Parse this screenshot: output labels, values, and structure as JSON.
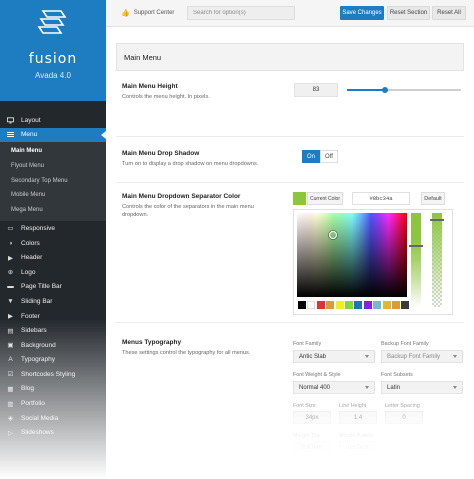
{
  "brand": {
    "name": "fusion",
    "version": "Avada 4.0"
  },
  "sidebar": {
    "items": [
      {
        "label": "Layout",
        "icon": "monitor-icon"
      },
      {
        "label": "Menu",
        "icon": "menu-lines-icon",
        "active": true
      },
      {
        "label": "Responsive",
        "icon": "devices-icon"
      },
      {
        "label": "Colors",
        "icon": "palette-icon"
      },
      {
        "label": "Header",
        "icon": "header-icon"
      },
      {
        "label": "Logo",
        "icon": "plus-circle-icon"
      },
      {
        "label": "Page Title Bar",
        "icon": "page-title-icon"
      },
      {
        "label": "Sliding Bar",
        "icon": "sliding-bar-icon"
      },
      {
        "label": "Footer",
        "icon": "footer-icon"
      },
      {
        "label": "Sidebars",
        "icon": "sidebar-icon"
      },
      {
        "label": "Background",
        "icon": "image-icon"
      },
      {
        "label": "Typography",
        "icon": "typography-icon"
      },
      {
        "label": "Shortcodes Styling",
        "icon": "check-square-icon"
      },
      {
        "label": "Blog",
        "icon": "blog-icon"
      },
      {
        "label": "Portfolio",
        "icon": "portfolio-icon"
      },
      {
        "label": "Social Media",
        "icon": "share-icon"
      },
      {
        "label": "Slideshows",
        "icon": "slideshow-icon"
      }
    ],
    "submenu": [
      {
        "label": "Main Menu",
        "current": true
      },
      {
        "label": "Flyout Menu"
      },
      {
        "label": "Secondary Top Menu"
      },
      {
        "label": "Mobile Menu"
      },
      {
        "label": "Mega Menu"
      }
    ]
  },
  "topbar": {
    "support_label": "Support Center",
    "search_placeholder": "Search for option(s)",
    "save_label": "Save Changes",
    "reset_section_label": "Reset Section",
    "reset_all_label": "Reset All"
  },
  "section": {
    "title": "Main Menu"
  },
  "menu_height": {
    "title": "Main Menu Height",
    "desc": "Controls the menu height. In pixels.",
    "value": "83",
    "slider_fraction": 0.33
  },
  "drop_shadow": {
    "title": "Main Menu Drop Shadow",
    "desc": "Turn on to display a drop shadow on menu dropdowns.",
    "on_label": "On",
    "off_label": "Off",
    "state": "on"
  },
  "separator_color": {
    "title": "Main Menu Dropdown Separator Color",
    "desc": "Controls the color of the separators in the main menu dropdown.",
    "current_label": "Current Color",
    "hex_value": "#8bc34a",
    "default_label": "Default",
    "current_color": "#8cc63f",
    "chips": [
      "#000000",
      "#ffffff",
      "#dd3333",
      "#dd9933",
      "#eeee22",
      "#81d742",
      "#1e73be",
      "#8224e3",
      "#7ab5d4",
      "#e4b62b",
      "#dd9933",
      "#3a3a3a"
    ]
  },
  "typography": {
    "title": "Menus Typography",
    "desc": "These settings control the typography for all menus.",
    "font_family_label": "Font Family",
    "font_family_value": "Antic Slab",
    "backup_family_label": "Backup Font Family",
    "backup_family_value": "Backup Font Family",
    "weight_label": "Font Weight & Style",
    "weight_value": "Normal 400",
    "subsets_label": "Font Subsets",
    "subsets_value": "Latin",
    "size_label": "Font Size",
    "size_value": "34px",
    "line_height_label": "Line Height",
    "line_height_value": "1.4",
    "letter_spacing_label": "Letter Spacing",
    "letter_spacing_value": "0",
    "margin_top_label": "Margin Top",
    "margin_top_value": "0.67em",
    "margin_bottom_label": "Margin Bottom",
    "margin_bottom_value": "0.67em"
  }
}
